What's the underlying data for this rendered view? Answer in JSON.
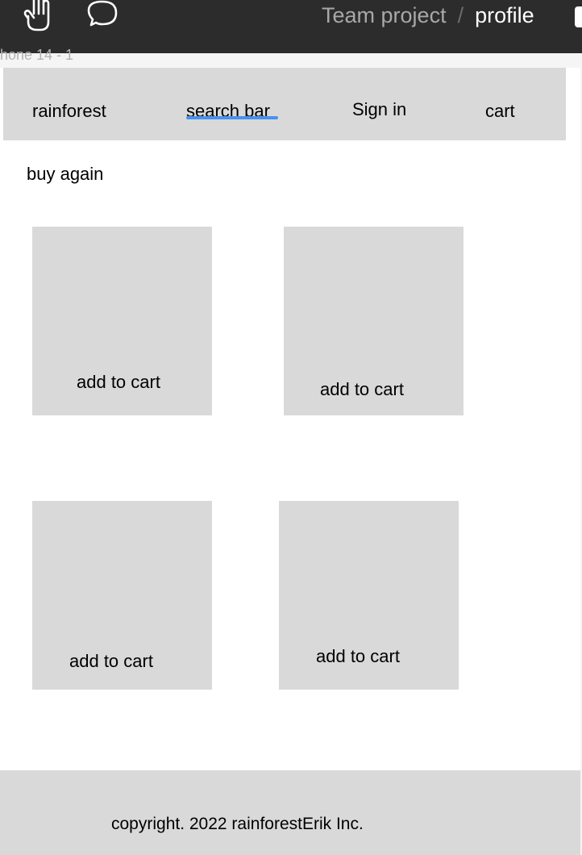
{
  "toolbar": {
    "hand_tool_icon": "hand-icon",
    "comment_tool_icon": "speech-bubble-icon",
    "breadcrumb": {
      "project": "Team project",
      "separator": "/",
      "page": "profile"
    }
  },
  "frame": {
    "label": "hone 14 - 1"
  },
  "nav": {
    "logo": "rainforest",
    "search": "search bar",
    "signin": "Sign in",
    "cart": "cart"
  },
  "section": {
    "title": "buy again"
  },
  "products": [
    {
      "button_label": "add to cart"
    },
    {
      "button_label": "add to cart"
    },
    {
      "button_label": "add to cart"
    },
    {
      "button_label": "add to cart"
    }
  ],
  "footer": {
    "copyright": "copyright. 2022 rainforestErik Inc."
  },
  "colors": {
    "toolbar_bg": "#2c2c2c",
    "placeholder_gray": "#d9d9d9",
    "search_underline": "#4a90f0",
    "canvas_bg": "#f5f5f5"
  }
}
